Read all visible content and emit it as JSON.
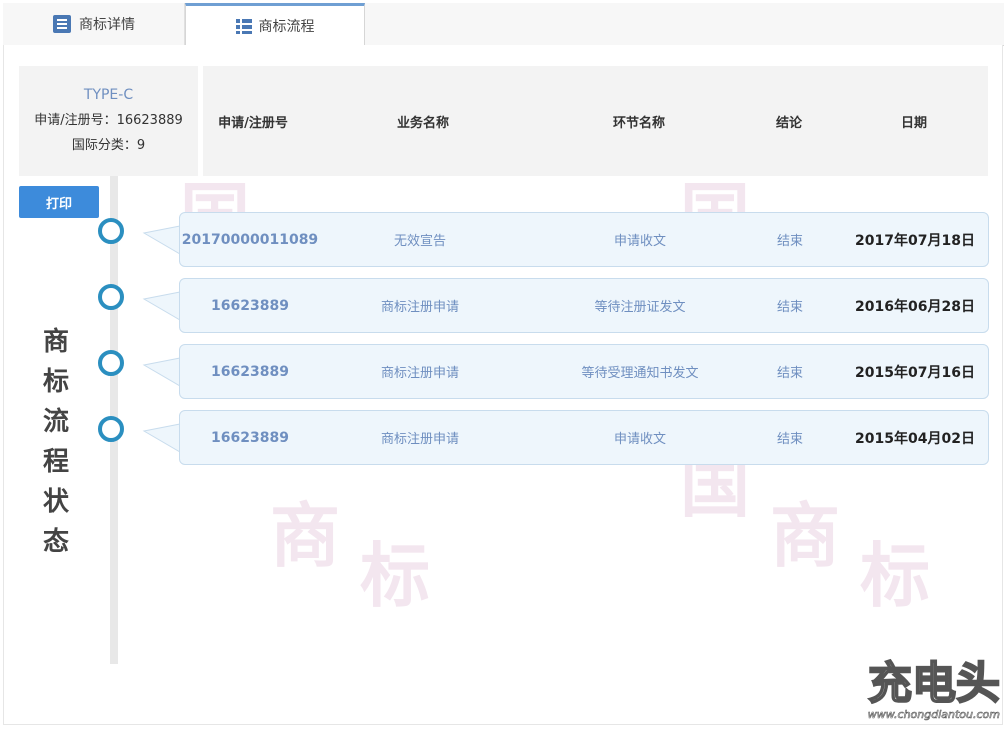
{
  "tabs": [
    {
      "label": "商标详情",
      "icon": "document-list-icon",
      "active": false
    },
    {
      "label": "商标流程",
      "icon": "grid-list-icon",
      "active": true
    }
  ],
  "summary": {
    "type": "TYPE-C",
    "reg_no_line": "申请/注册号：16623889",
    "class_line": "国际分类：9"
  },
  "columns": [
    "申请/注册号",
    "业务名称",
    "环节名称",
    "结论",
    "日期"
  ],
  "print_label": "打印",
  "side_title": [
    "商",
    "标",
    "流",
    "程",
    "状",
    "态"
  ],
  "rows": [
    {
      "no": "20170000011089",
      "business": "无效宣告",
      "step": "申请收文",
      "result": "结束",
      "date": "2017年07月18日"
    },
    {
      "no": "16623889",
      "business": "商标注册申请",
      "step": "等待注册证发文",
      "result": "结束",
      "date": "2016年06月28日"
    },
    {
      "no": "16623889",
      "business": "商标注册申请",
      "step": "等待受理通知书发文",
      "result": "结束",
      "date": "2015年07月16日"
    },
    {
      "no": "16623889",
      "business": "商标注册申请",
      "step": "申请收文",
      "result": "结束",
      "date": "2015年04月02日"
    }
  ],
  "watermark": {
    "logo_text": "充电头",
    "url": "www.chongdiantou.com"
  },
  "colors": {
    "accent": "#3d8bdb",
    "dot": "#2b8fc0",
    "link_text": "#6f8fc0",
    "card_bg": "#eef6fc"
  }
}
